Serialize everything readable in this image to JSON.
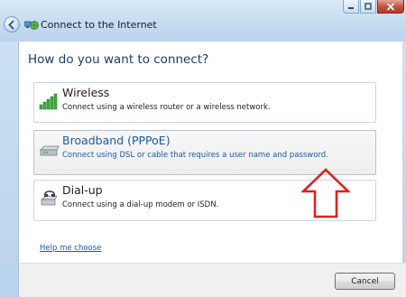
{
  "window": {
    "title": "Connect to the Internet"
  },
  "heading": "How do you want to connect?",
  "options": [
    {
      "title": "Wireless",
      "description": "Connect using a wireless router or a wireless network.",
      "icon": "wireless-signal-icon"
    },
    {
      "title": "Broadband (PPPoE)",
      "description": "Connect using DSL or cable that requires a user name and password.",
      "icon": "broadband-modem-icon",
      "selected": true
    },
    {
      "title": "Dial-up",
      "description": "Connect using a dial-up modem or ISDN.",
      "icon": "dialup-phone-icon"
    }
  ],
  "help_link": "Help me choose",
  "footer": {
    "cancel_label": "Cancel"
  },
  "colors": {
    "annotation_arrow": "#e02020",
    "heading": "#1e3a73",
    "selected_text": "#1e5aa3",
    "link": "#1e55b3"
  }
}
